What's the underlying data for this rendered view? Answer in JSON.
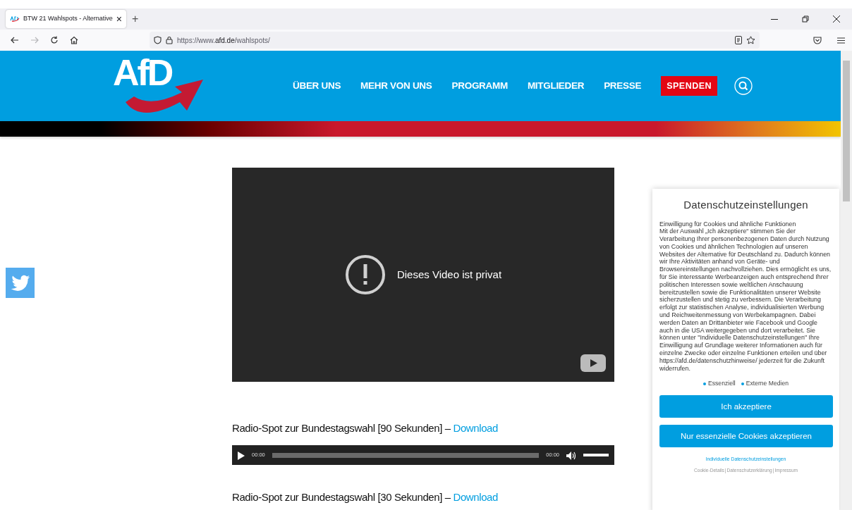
{
  "browser": {
    "tab_title": "BTW 21 Wahlspots - Alternative",
    "tab_close": "×",
    "new_tab": "+",
    "url": "https://www.**afd.de**/wahlspots/",
    "forward_disabled": true
  },
  "site": {
    "logo": "AfD",
    "nav": [
      {
        "label": "ÜBER UNS",
        "kind": "link"
      },
      {
        "label": "MEHR VON UNS",
        "kind": "link"
      },
      {
        "label": "PROGRAMM",
        "kind": "link"
      },
      {
        "label": "MITGLIEDER",
        "kind": "link"
      },
      {
        "label": "PRESSE",
        "kind": "link"
      },
      {
        "label": "SPENDEN",
        "kind": "button"
      }
    ]
  },
  "video": {
    "message": "Dieses Video ist privat"
  },
  "spots": [
    {
      "title": "Radio-Spot zur Bundestagswahl [90 Sekunden] – ",
      "link": "Download",
      "player": {
        "time": "00:00",
        "duration": "00:00",
        "level": 0,
        "volume": {
          "level": 1
        }
      }
    },
    {
      "title": "Radio-Spot zur Bundestagswahl [30 Sekunden] – ",
      "link": "Download"
    }
  ],
  "cookie_panel": {
    "title": "Datenschutzeinstellungen",
    "intro_heading": "Einwilligung für Cookies und ähnliche Funktionen",
    "body": "Mit der Auswahl „Ich akzeptiere“ stimmen Sie der Verarbeitung Ihrer personenbezogenen Daten durch Nutzung von Cookies und ähnlichen Technologien auf unseren Websites der Alternative für Deutschland zu. Dadurch können wir Ihre Aktivitäten anhand von Geräte- und Browsereinstellungen nachvollziehen. Dies ermöglicht es uns, für Sie interessante Werbeanzeigen auch entsprechend Ihrer politischen Interessen sowie weltlichen Anschauung bereitzustellen sowie die Funktionalitäten unserer Website sicherzustellen und stetig zu verbessern. Die Verarbeitung erfolgt zur statistischen Analyse, individualisierten Werbung und Reichweitenmessung von Werbekampagnen. Dabei werden Daten an Drittanbieter wie Facebook und Google auch in die USA weitergegeben und dort verarbeitet. Sie können unter \"Individuelle Datenschutzeinstellungen\" Ihre Einwilligung auf Grundlage weiterer Informationen auch für einzelne Zwecke oder einzelne Funktionen erteilen und über https://afd.de/datenschutzhinweise/ jederzeit für die Zukunft widerrufen.",
    "categories": [
      {
        "label": "Essenziell",
        "color": "#009ee0"
      },
      {
        "label": "Externe Medien",
        "color": "#009ee0"
      }
    ],
    "buttons": [
      "Ich akzeptiere",
      "Nur essenzielle Cookies akzeptieren"
    ],
    "settings_link": "Individuelle Datenschutzeinstellungen",
    "footer_links": [
      "Cookie-Details",
      "Datenschutzerklärung",
      "Impressum"
    ],
    "footer_separator": "|"
  }
}
